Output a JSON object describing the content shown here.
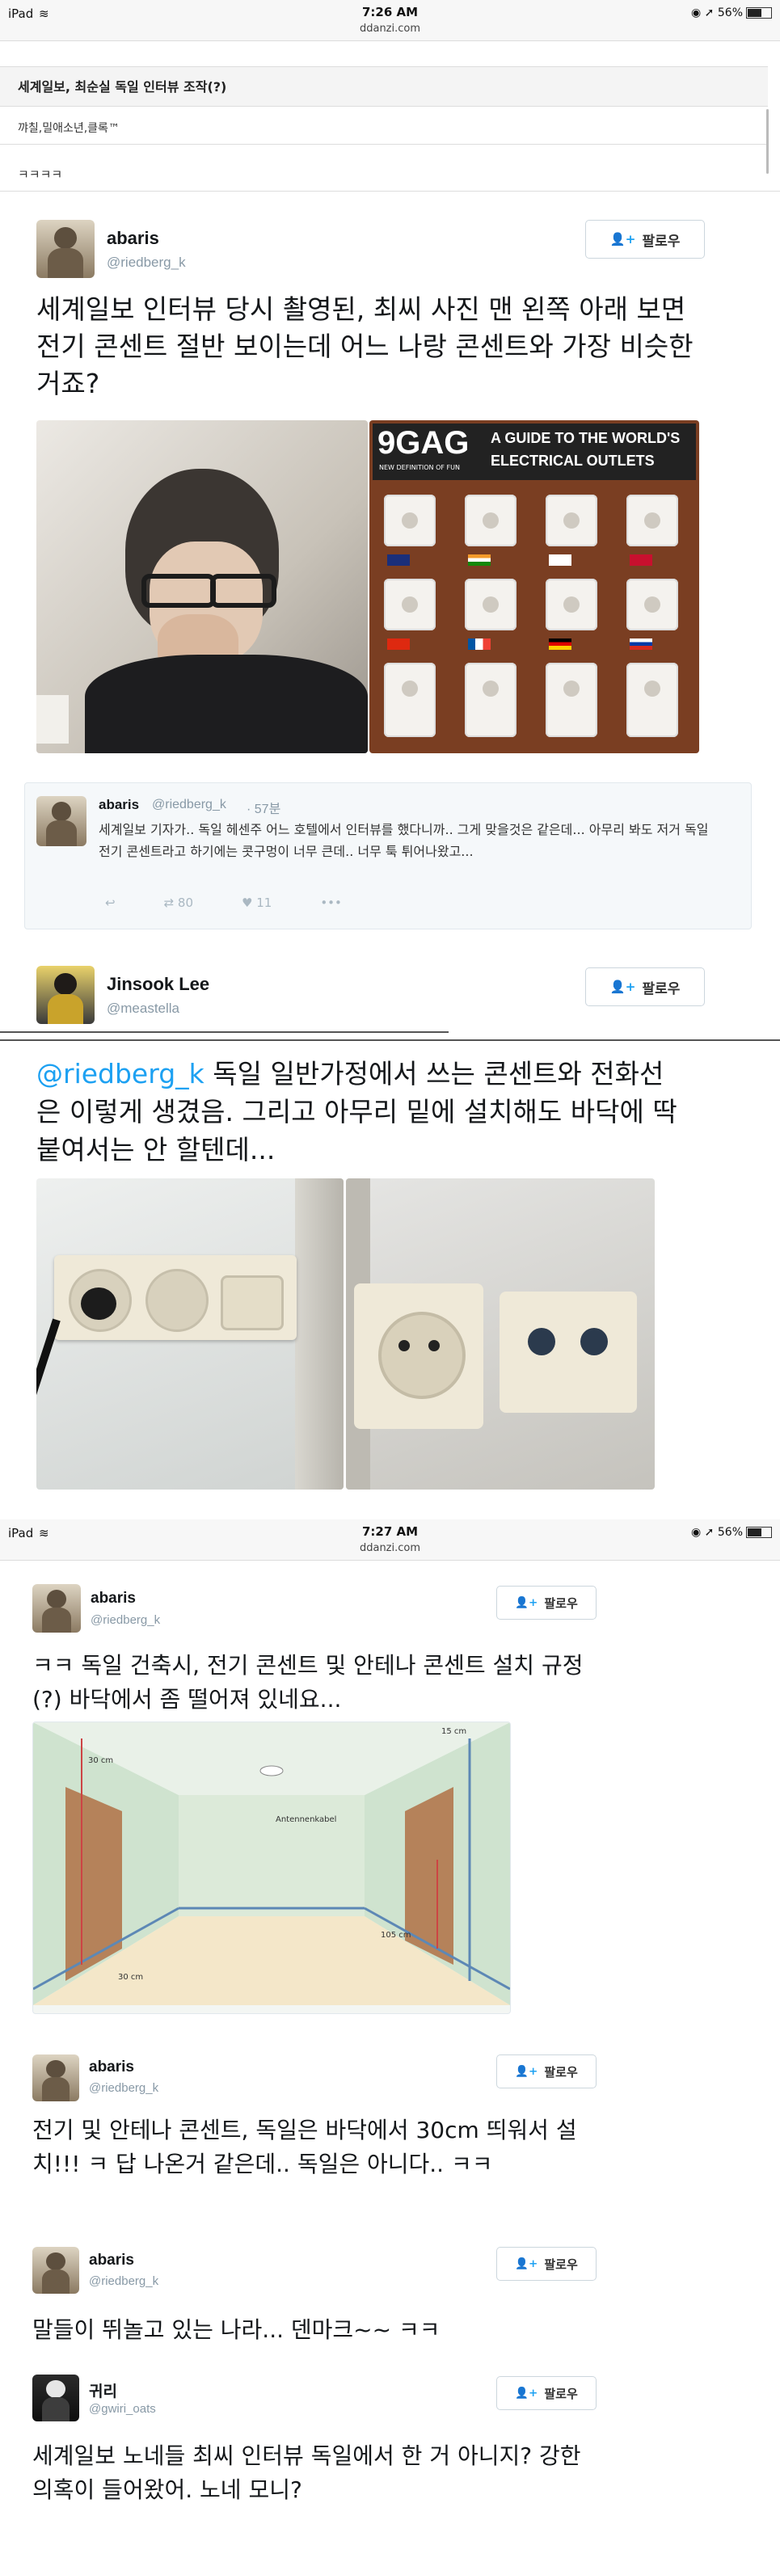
{
  "status_bar_1": {
    "device": "iPad",
    "time": "7:26 AM",
    "url": "ddanzi.com",
    "battery": "56%"
  },
  "status_bar_2": {
    "device": "iPad",
    "time": "7:27 AM",
    "url": "ddanzi.com",
    "battery": "56%"
  },
  "board": {
    "title": "세계일보, 최순실 독일 인터뷰 조작(?)",
    "author": "꺄칠,밀애소년,클록™",
    "body": "ㅋㅋㅋㅋ"
  },
  "tweet1": {
    "name": "abaris",
    "handle": "@riedberg_k",
    "follow": "팔로우",
    "text": "세계일보 인터뷰 당시 촬영된, 최씨 사진 맨 왼쪽 아래 보면 전기 콘센트 절반 보이는데 어느 나랑 콘센트와 가장 비슷한거죠?",
    "image_banner": {
      "brand": "9GAG",
      "tagline": "NEW DEFINITION OF FUN",
      "title_line1": "A GUIDE TO THE WORLD'S",
      "title_line2": "ELECTRICAL OUTLETS"
    }
  },
  "reply1": {
    "name": "abaris",
    "handle": "@riedberg_k",
    "age": "· 57분",
    "text": "세계일보 기자가.. 독일 헤센주 어느 호텔에서 인터뷰를 했다니까.. 그게 맞을것은 같은데... 아무리 봐도 저거 독일 전기 콘센트라고 하기에는 콧구멍이 너무 큰데.. 너무 툭 튀어나왔고...",
    "retweets": "80",
    "likes": "11"
  },
  "tweet2": {
    "name": "Jinsook Lee",
    "handle": "@meastella",
    "follow": "팔로우",
    "mention": "@riedberg_k",
    "text": "독일 일반가정에서 쓰는 콘센트와 전화선은 이렇게 생겼음. 그리고 아무리 밑에 설치해도 바닥에 딱붙여서는 안 할텐데..."
  },
  "tweet3": {
    "name": "abaris",
    "handle": "@riedberg_k",
    "follow": "팔로우",
    "text": "ㅋㅋ 독일 건축시, 전기 콘센트 및 안테나 콘센트 설치 규정(?) 바닥에서 좀 떨어져 있네요...",
    "diagram": {
      "label1": "15 cm",
      "label2": "30 cm",
      "label3": "Antennenkabel",
      "label4": "105 cm",
      "label5": "30 cm"
    }
  },
  "tweet4": {
    "name": "abaris",
    "handle": "@riedberg_k",
    "follow": "팔로우",
    "text": "전기 및 안테나 콘센트, 독일은 바닥에서 30cm 띄워서 설치!!! ㅋ 답 나온거 같은데.. 독일은 아니다.. ㅋㅋ"
  },
  "tweet5": {
    "name": "abaris",
    "handle": "@riedberg_k",
    "follow": "팔로우",
    "text": "말들이 뛰놀고 있는 나라... 덴마크~~ ㅋㅋ"
  },
  "tweet6": {
    "name": "귀리",
    "handle": "@gwiri_oats",
    "follow": "팔로우",
    "text": "세계일보 노네들 최씨 인터뷰 독일에서 한 거 아니지? 강한 의혹이 들어왔어. 노네 모니?"
  },
  "colors": {
    "twitter_blue": "#1da1f2",
    "handle_gray": "#8899a6"
  }
}
